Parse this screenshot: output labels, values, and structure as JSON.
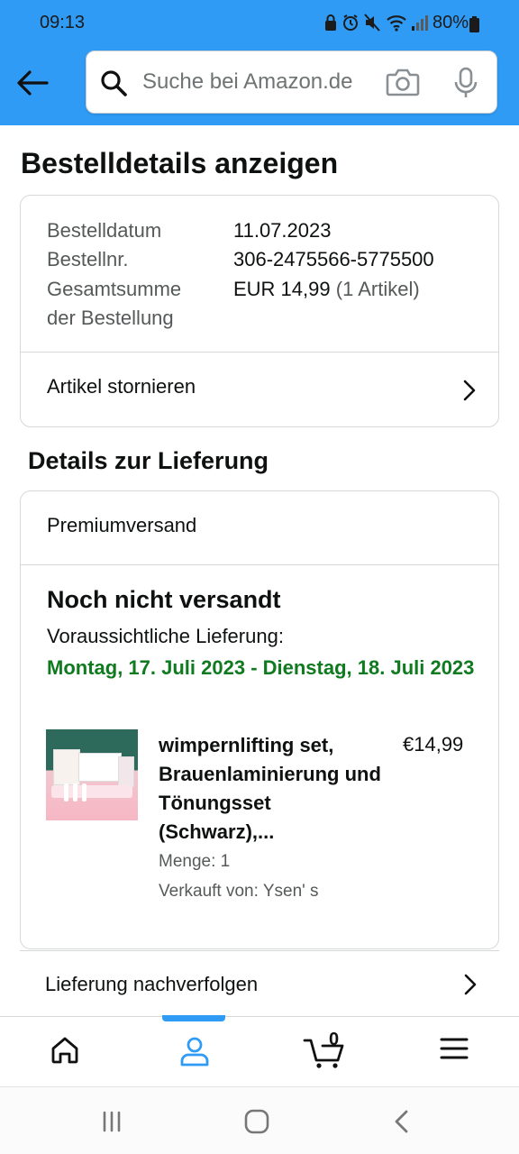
{
  "status_bar": {
    "time": "09:13",
    "battery": "80%"
  },
  "header": {
    "search_placeholder": "Suche bei Amazon.de",
    "accent_color": "#2f9bf4"
  },
  "page": {
    "title": "Bestelldetails anzeigen"
  },
  "order_summary": {
    "date_label": "Bestelldatum",
    "date_value": "11.07.2023",
    "number_label": "Bestellnr.",
    "number_value": "306-2475566-5775500",
    "total_label_line1": "Gesamtsumme",
    "total_label_line2": "der Bestellung",
    "total_value": "EUR 14,99",
    "total_items": "(1 Artikel)",
    "cancel_label": "Artikel stornieren"
  },
  "delivery": {
    "section_title": "Details zur Lieferung",
    "shipping_method": "Premiumversand",
    "status": "Noch nicht versandt",
    "eta_label": "Voraussichtliche Lieferung:",
    "eta_date": "Montag, 17. Juli 2023 - Dienstag, 18. Juli 2023",
    "eta_color": "#0f7a1f",
    "item": {
      "name": "wimpernlifting set, Brauenlaminierung und Tönungsset (Schwarz),...",
      "price": "€14,99",
      "quantity": "Menge: 1",
      "seller": "Verkauft von: Ysen' s"
    },
    "track_label": "Lieferung nachverfolgen"
  },
  "bottom_nav": {
    "items": [
      "home-icon",
      "account-icon",
      "cart-icon",
      "menu-icon"
    ],
    "cart_count": "0",
    "active": "account"
  }
}
